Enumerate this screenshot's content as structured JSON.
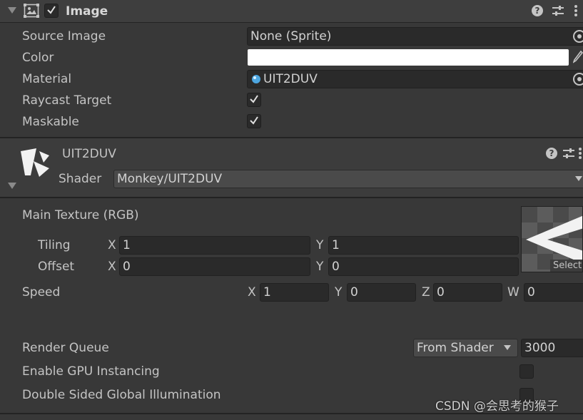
{
  "image_component": {
    "title": "Image",
    "enabled": true,
    "fields": {
      "source_image_label": "Source Image",
      "source_image_value": "None (Sprite)",
      "color_label": "Color",
      "color_value": "#ffffff",
      "material_label": "Material",
      "material_value": "UIT2DUV",
      "raycast_label": "Raycast Target",
      "raycast_checked": true,
      "maskable_label": "Maskable",
      "maskable_checked": true
    }
  },
  "material": {
    "name": "UIT2DUV",
    "shader_label": "Shader",
    "shader_value": "Monkey/UIT2DUV",
    "main_texture_label": "Main Texture (RGB)",
    "tiling_label": "Tiling",
    "tiling_x_axis": "X",
    "tiling_x": "1",
    "tiling_y_axis": "Y",
    "tiling_y": "1",
    "offset_label": "Offset",
    "offset_x_axis": "X",
    "offset_x": "0",
    "offset_y_axis": "Y",
    "offset_y": "0",
    "texture_select_label": "Select",
    "speed_label": "Speed",
    "speed_x_axis": "X",
    "speed_x": "1",
    "speed_y_axis": "Y",
    "speed_y": "0",
    "speed_z_axis": "Z",
    "speed_z": "0",
    "speed_w_axis": "W",
    "speed_w": "0",
    "render_queue_label": "Render Queue",
    "render_queue_mode": "From Shader",
    "render_queue_value": "3000",
    "gpu_instancing_label": "Enable GPU Instancing",
    "gpu_instancing_checked": false,
    "double_sided_gi_label": "Double Sided Global Illumination",
    "double_sided_gi_checked": false
  },
  "watermark": "CSDN @会思考的猴子",
  "icons": [
    "foldout-arrow-icon",
    "image-component-icon",
    "help-icon",
    "presets-icon",
    "more-menu-icon",
    "object-picker-icon",
    "eyedropper-icon",
    "material-sphere-icon",
    "unity-logo-icon",
    "dropdown-arrow-icon",
    "checkmark-icon"
  ]
}
